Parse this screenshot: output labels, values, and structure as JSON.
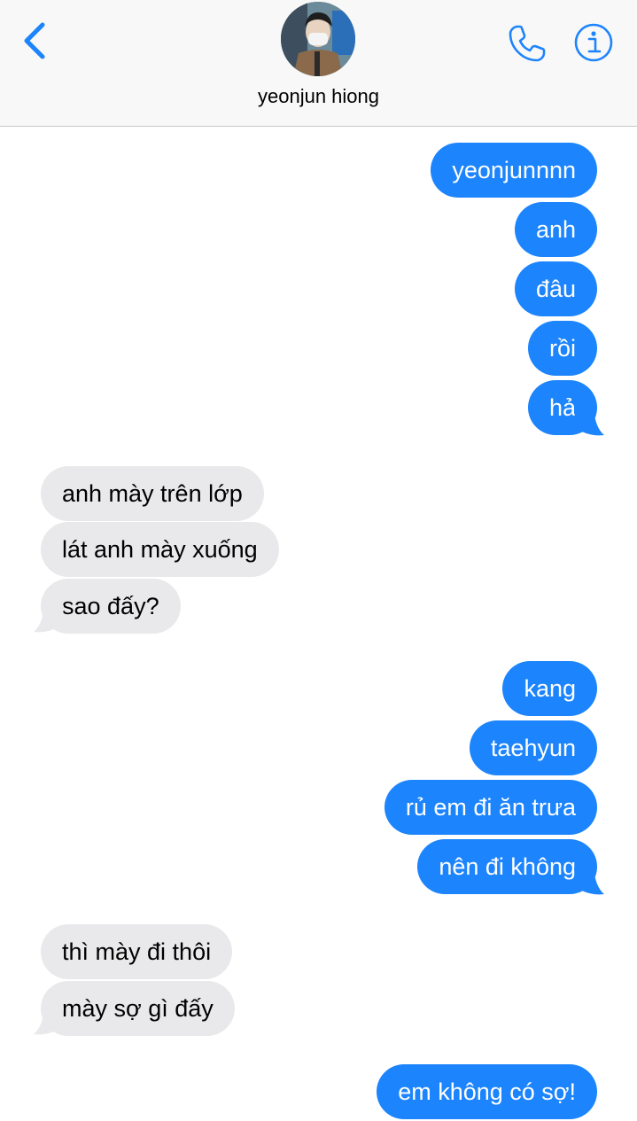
{
  "header": {
    "contact_name": "yeonjun hiong",
    "back_icon": "chevron-left-icon",
    "call_icon": "phone-icon",
    "info_icon": "info-icon",
    "accent_color": "#1c84fc"
  },
  "messages": [
    {
      "from": "me",
      "text": "yeonjunnnn"
    },
    {
      "from": "me",
      "text": "anh"
    },
    {
      "from": "me",
      "text": "đâu"
    },
    {
      "from": "me",
      "text": "rồi"
    },
    {
      "from": "me",
      "text": "hả"
    },
    {
      "from": "them",
      "text": "anh mày trên lớp"
    },
    {
      "from": "them",
      "text": "lát anh mày xuống"
    },
    {
      "from": "them",
      "text": "sao đấy?"
    },
    {
      "from": "me",
      "text": "kang"
    },
    {
      "from": "me",
      "text": "taehyun"
    },
    {
      "from": "me",
      "text": "rủ em đi ăn trưa"
    },
    {
      "from": "me",
      "text": "nên đi không"
    },
    {
      "from": "them",
      "text": "thì mày đi thôi"
    },
    {
      "from": "them",
      "text": "mày sợ gì đấy"
    },
    {
      "from": "me",
      "text": "em không có sợ!"
    }
  ],
  "colors": {
    "sent_bubble": "#1c84fc",
    "received_bubble": "#e9e9eb"
  }
}
